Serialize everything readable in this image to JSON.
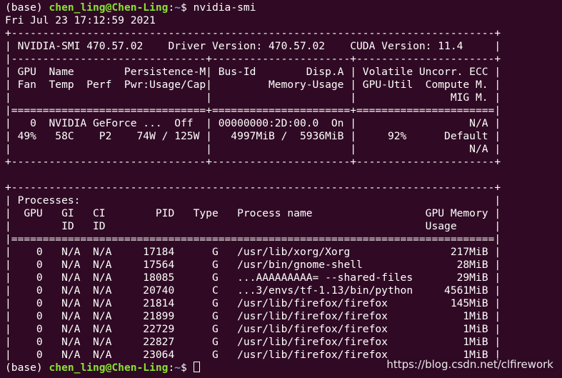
{
  "colors": {
    "background": "#300a24",
    "text": "#ffffff",
    "prompt_user": "#8ae234",
    "prompt_path": "#729fcf"
  },
  "prompt": {
    "env": "(base) ",
    "user_host": "chen_ling@Chen-Ling",
    "colon": ":",
    "path": "~",
    "symbol": "$ ",
    "command": "nvidia-smi"
  },
  "output_lines": [
    "Fri Jul 23 17:12:59 2021",
    "+-----------------------------------------------------------------------------+",
    "| NVIDIA-SMI 470.57.02    Driver Version: 470.57.02    CUDA Version: 11.4     |",
    "|-------------------------------+----------------------+----------------------+",
    "| GPU  Name        Persistence-M| Bus-Id        Disp.A | Volatile Uncorr. ECC |",
    "| Fan  Temp  Perf  Pwr:Usage/Cap|         Memory-Usage | GPU-Util  Compute M. |",
    "|                               |                      |               MIG M. |",
    "|===============================+======================+======================|",
    "|   0  NVIDIA GeForce ...  Off  | 00000000:2D:00.0  On |                  N/A |",
    "| 49%   58C    P2    74W / 125W |   4997MiB /  5936MiB |     92%      Default |",
    "|                               |                      |                  N/A |",
    "+-------------------------------+----------------------+----------------------+",
    "",
    "+-----------------------------------------------------------------------------+",
    "| Processes:                                                                  |",
    "|  GPU   GI   CI        PID   Type   Process name                  GPU Memory |",
    "|        ID   ID                                                   Usage      |",
    "|=============================================================================|",
    "|    0   N/A  N/A     17184      G   /usr/lib/xorg/Xorg                217MiB |",
    "|    0   N/A  N/A     17564      G   /usr/bin/gnome-shell               28MiB |",
    "|    0   N/A  N/A     18085      G   ...AAAAAAAAA= --shared-files       29MiB |",
    "|    0   N/A  N/A     20740      C   ...3/envs/tf-1.13/bin/python     4561MiB |",
    "|    0   N/A  N/A     21814      G   /usr/lib/firefox/firefox          145MiB |",
    "|    0   N/A  N/A     21899      G   /usr/lib/firefox/firefox            1MiB |",
    "|    0   N/A  N/A     22729      G   /usr/lib/firefox/firefox            1MiB |",
    "|    0   N/A  N/A     22827      G   /usr/lib/firefox/firefox            1MiB |",
    "|    0   N/A  N/A     23064      G   /usr/lib/firefox/firefox            1MiB |"
  ],
  "watermark": "https://blog.csdn.net/clfirework"
}
